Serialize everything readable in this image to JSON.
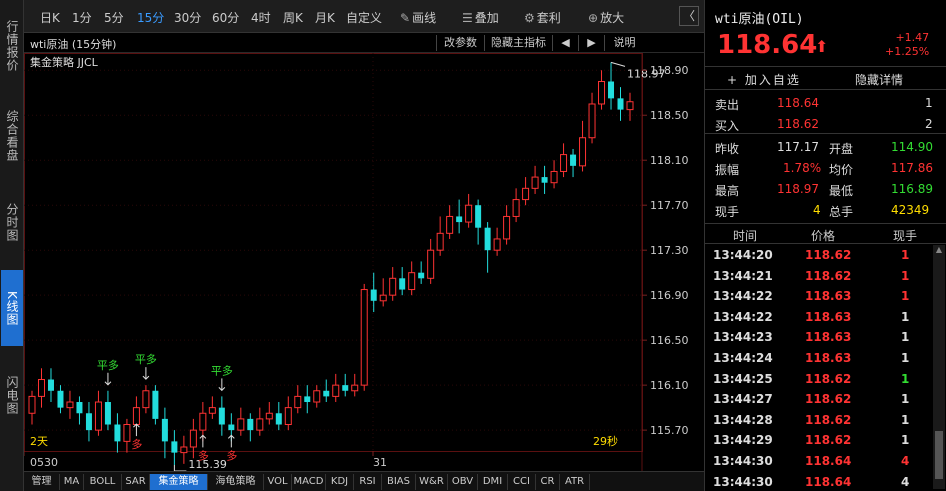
{
  "left_tabs": [
    {
      "label": "行情报价",
      "active": false
    },
    {
      "label": "综合看盘",
      "active": false
    },
    {
      "label": "分时图",
      "active": false
    },
    {
      "label": "K线图",
      "active": true
    },
    {
      "label": "闪电图",
      "active": false
    }
  ],
  "toolbar": {
    "periods": [
      "日K",
      "1分",
      "5分",
      "15分",
      "30分",
      "60分",
      "4时",
      "周K",
      "月K",
      "自定义"
    ],
    "active_period": "15分",
    "draw_label": "画线",
    "overlay_label": "叠加",
    "arbitrage_label": "套利",
    "zoom_label": "放大",
    "nav_label": "〈"
  },
  "chart_header": {
    "title": "wti原油 (15分钟)",
    "buttons": [
      "改参数",
      "隐藏主指标",
      "◀",
      "▶",
      "说明"
    ],
    "strategy": "集金策略 JJCL"
  },
  "chart_data": {
    "type": "candlestick",
    "ylim": [
      115.55,
      119.0
    ],
    "yticks": [
      "118.90",
      "118.50",
      "118.10",
      "117.70",
      "117.30",
      "116.90",
      "116.50",
      "116.10",
      "115.70"
    ],
    "xticks": [
      "0530",
      "31"
    ],
    "high_label": "118.97",
    "low_label": "115.39",
    "left_note": "2天",
    "right_note": "29秒",
    "signals": [
      {
        "text": "平多",
        "index": 8,
        "kind": "close"
      },
      {
        "text": "平多",
        "index": 12,
        "kind": "close"
      },
      {
        "text": "平多",
        "index": 20,
        "kind": "close"
      },
      {
        "text": "多",
        "index": 11,
        "kind": "open"
      },
      {
        "text": "多",
        "index": 18,
        "kind": "open"
      },
      {
        "text": "多",
        "index": 21,
        "kind": "open"
      }
    ],
    "candles": [
      [
        115.85,
        116.0,
        116.05,
        115.75
      ],
      [
        116.0,
        116.15,
        116.25,
        115.9
      ],
      [
        116.15,
        116.05,
        116.25,
        115.95
      ],
      [
        116.05,
        115.9,
        116.1,
        115.85
      ],
      [
        115.9,
        115.95,
        116.05,
        115.8
      ],
      [
        115.95,
        115.85,
        116.0,
        115.75
      ],
      [
        115.85,
        115.7,
        115.95,
        115.6
      ],
      [
        115.7,
        115.95,
        116.05,
        115.65
      ],
      [
        115.95,
        115.75,
        116.05,
        115.7
      ],
      [
        115.75,
        115.6,
        115.85,
        115.5
      ],
      [
        115.6,
        115.75,
        115.8,
        115.5
      ],
      [
        115.75,
        115.9,
        116.0,
        115.7
      ],
      [
        115.9,
        116.05,
        116.1,
        115.85
      ],
      [
        116.05,
        115.8,
        116.1,
        115.75
      ],
      [
        115.8,
        115.6,
        115.9,
        115.45
      ],
      [
        115.6,
        115.5,
        115.7,
        115.39
      ],
      [
        115.5,
        115.55,
        115.65,
        115.4
      ],
      [
        115.55,
        115.7,
        115.8,
        115.45
      ],
      [
        115.7,
        115.85,
        115.95,
        115.6
      ],
      [
        115.85,
        115.9,
        116.0,
        115.8
      ],
      [
        115.9,
        115.75,
        116.0,
        115.65
      ],
      [
        115.75,
        115.7,
        115.85,
        115.6
      ],
      [
        115.7,
        115.8,
        115.9,
        115.65
      ],
      [
        115.8,
        115.7,
        115.85,
        115.6
      ],
      [
        115.7,
        115.8,
        115.9,
        115.65
      ],
      [
        115.8,
        115.85,
        115.95,
        115.75
      ],
      [
        115.85,
        115.75,
        115.95,
        115.7
      ],
      [
        115.75,
        115.9,
        116.0,
        115.7
      ],
      [
        115.9,
        116.0,
        116.1,
        115.85
      ],
      [
        116.0,
        115.95,
        116.1,
        115.85
      ],
      [
        115.95,
        116.05,
        116.1,
        115.9
      ],
      [
        116.05,
        116.0,
        116.15,
        115.95
      ],
      [
        116.0,
        116.1,
        116.2,
        115.95
      ],
      [
        116.1,
        116.05,
        116.2,
        116.0
      ],
      [
        116.05,
        116.1,
        116.2,
        116.0
      ],
      [
        116.1,
        116.95,
        117.0,
        116.05
      ],
      [
        116.95,
        116.85,
        117.1,
        116.75
      ],
      [
        116.85,
        116.9,
        117.05,
        116.8
      ],
      [
        116.9,
        117.05,
        117.15,
        116.85
      ],
      [
        117.05,
        116.95,
        117.15,
        116.9
      ],
      [
        116.95,
        117.1,
        117.2,
        116.9
      ],
      [
        117.1,
        117.05,
        117.2,
        117.0
      ],
      [
        117.05,
        117.3,
        117.4,
        117.0
      ],
      [
        117.3,
        117.45,
        117.6,
        117.25
      ],
      [
        117.45,
        117.6,
        117.7,
        117.4
      ],
      [
        117.6,
        117.55,
        117.75,
        117.45
      ],
      [
        117.55,
        117.7,
        117.8,
        117.5
      ],
      [
        117.7,
        117.5,
        117.75,
        117.35
      ],
      [
        117.5,
        117.3,
        117.55,
        117.1
      ],
      [
        117.3,
        117.4,
        117.5,
        117.25
      ],
      [
        117.4,
        117.6,
        117.7,
        117.35
      ],
      [
        117.6,
        117.75,
        117.85,
        117.55
      ],
      [
        117.75,
        117.85,
        117.95,
        117.7
      ],
      [
        117.85,
        117.95,
        118.05,
        117.8
      ],
      [
        117.95,
        117.9,
        118.05,
        117.8
      ],
      [
        117.9,
        118.0,
        118.1,
        117.85
      ],
      [
        118.0,
        118.15,
        118.25,
        117.95
      ],
      [
        118.15,
        118.05,
        118.2,
        117.95
      ],
      [
        118.05,
        118.3,
        118.45,
        118.0
      ],
      [
        118.3,
        118.6,
        118.7,
        118.25
      ],
      [
        118.6,
        118.8,
        118.9,
        118.55
      ],
      [
        118.8,
        118.65,
        118.97,
        118.55
      ],
      [
        118.65,
        118.55,
        118.75,
        118.45
      ],
      [
        118.55,
        118.62,
        118.7,
        118.45
      ]
    ]
  },
  "indicators": [
    "管理",
    "MA",
    "BOLL",
    "SAR",
    "集金策略",
    "海龟策略",
    "VOL",
    "MACD",
    "KDJ",
    "RSI",
    "BIAS",
    "W&R",
    "OBV",
    "DMI",
    "CCI",
    "CR",
    "ATR"
  ],
  "active_indicator": "集金策略",
  "quote": {
    "title": "wti原油(OIL)",
    "price": "118.64",
    "arrow": "⬆",
    "change": "+1.47",
    "change_pct": "+1.25%",
    "add_watch": "+ 加入自选",
    "hide_detail": "隐藏详情",
    "sell_label": "卖出",
    "sell_price": "118.64",
    "sell_qty": "1",
    "buy_label": "买入",
    "buy_price": "118.62",
    "buy_qty": "2",
    "prev_close_label": "昨收",
    "prev_close": "117.17",
    "open_label": "开盘",
    "open": "114.90",
    "amplitude_label": "振幅",
    "amplitude": "1.78%",
    "avg_label": "均价",
    "avg": "117.86",
    "high_label": "最高",
    "high": "118.97",
    "low_label": "最低",
    "low": "116.89",
    "cur_vol_label": "现手",
    "cur_vol": "4",
    "total_vol_label": "总手",
    "total_vol": "42349"
  },
  "ticks": {
    "headers": [
      "时间",
      "价格",
      "现手"
    ],
    "rows": [
      {
        "time": "13:44:20",
        "price": "118.62",
        "qty": "1",
        "qty_color": "red"
      },
      {
        "time": "13:44:21",
        "price": "118.62",
        "qty": "1",
        "qty_color": "red"
      },
      {
        "time": "13:44:22",
        "price": "118.63",
        "qty": "1",
        "qty_color": "red"
      },
      {
        "time": "13:44:22",
        "price": "118.63",
        "qty": "1",
        "qty_color": "white"
      },
      {
        "time": "13:44:23",
        "price": "118.63",
        "qty": "1",
        "qty_color": "white"
      },
      {
        "time": "13:44:24",
        "price": "118.63",
        "qty": "1",
        "qty_color": "white"
      },
      {
        "time": "13:44:25",
        "price": "118.62",
        "qty": "1",
        "qty_color": "green"
      },
      {
        "time": "13:44:27",
        "price": "118.62",
        "qty": "1",
        "qty_color": "white"
      },
      {
        "time": "13:44:28",
        "price": "118.62",
        "qty": "1",
        "qty_color": "white"
      },
      {
        "time": "13:44:29",
        "price": "118.62",
        "qty": "1",
        "qty_color": "white"
      },
      {
        "time": "13:44:30",
        "price": "118.64",
        "qty": "4",
        "qty_color": "red"
      },
      {
        "time": "13:44:30",
        "price": "118.64",
        "qty": "4",
        "qty_color": "white"
      }
    ]
  },
  "colors": {
    "up": "#ff3333",
    "down": "#22dddd",
    "accent": "#1f6fd0",
    "signal_close": "#33dd33",
    "signal_open": "#ff3333"
  }
}
